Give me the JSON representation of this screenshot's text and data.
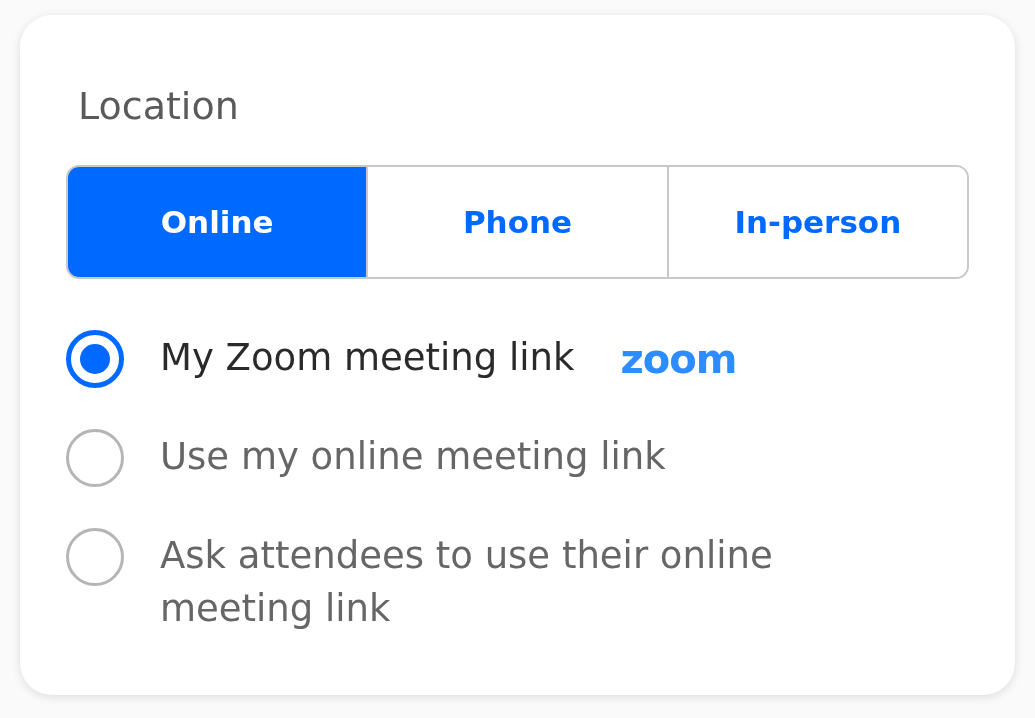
{
  "section": {
    "title": "Location"
  },
  "tabs": [
    {
      "label": "Online",
      "selected": true
    },
    {
      "label": "Phone",
      "selected": false
    },
    {
      "label": "In-person",
      "selected": false
    }
  ],
  "options": [
    {
      "label": "My Zoom meeting link",
      "selected": true,
      "logo": "zoom"
    },
    {
      "label": "Use my online meeting link",
      "selected": false
    },
    {
      "label": "Ask attendees to use their online meeting link",
      "selected": false
    }
  ]
}
